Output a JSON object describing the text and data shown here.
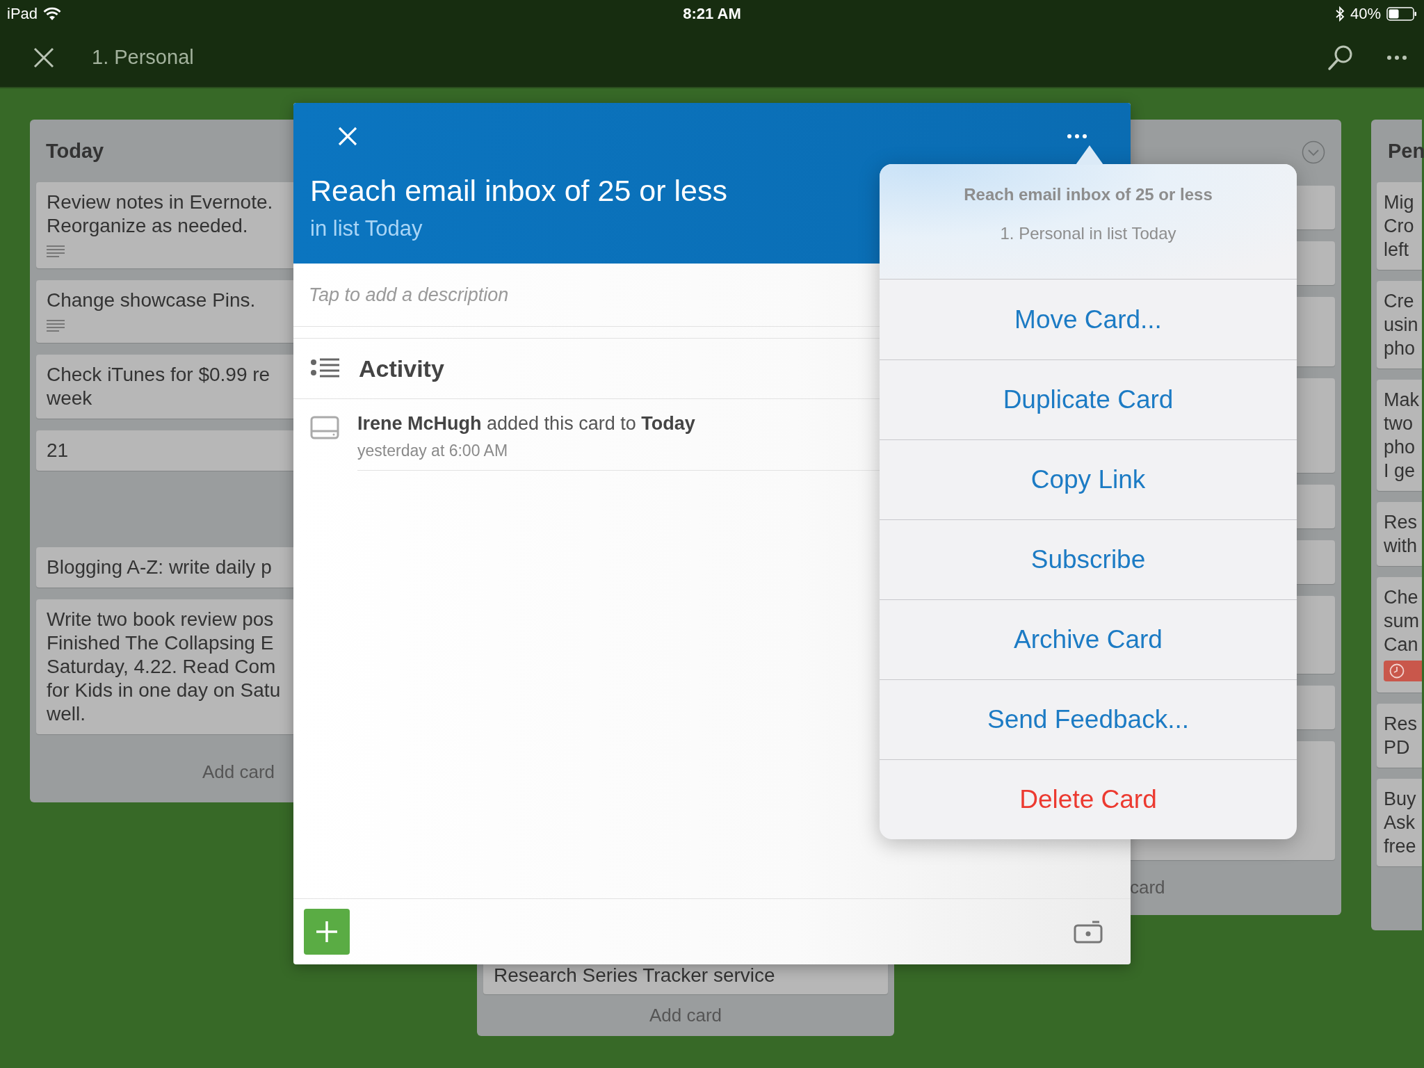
{
  "status_bar": {
    "device": "iPad",
    "time": "8:21 AM",
    "battery": "40%"
  },
  "nav": {
    "title": "1. Personal"
  },
  "lists": [
    {
      "title": "Today",
      "add_label": "Add card",
      "cards": [
        {
          "kind": "card",
          "text": "Review notes in Evernote.\nReorganize as needed.",
          "has_description": true
        },
        {
          "kind": "card",
          "text": "Change showcase Pins.",
          "has_description": true
        },
        {
          "kind": "card",
          "text": "Check iTunes for $0.99 re\nweek"
        },
        {
          "kind": "card",
          "text": "21"
        },
        {
          "kind": "placeholder"
        },
        {
          "kind": "card",
          "text": "Blogging A-Z: write daily p"
        },
        {
          "kind": "card",
          "text": "Write two book review pos\nFinished The Collapsing E\nSaturday, 4.22. Read Com\nfor Kids in one day on Satu\nwell."
        }
      ]
    },
    {
      "add_label": "Add card",
      "cards": [
        {
          "kind": "card",
          "text": "Research Series Tracker service"
        }
      ]
    },
    {
      "add_label": "card",
      "menu_icon": true,
      "cards": [
        {
          "kind": "blank"
        },
        {
          "kind": "blank"
        },
        {
          "kind": "blank"
        },
        {
          "kind": "blank"
        },
        {
          "kind": "blank"
        },
        {
          "kind": "blank"
        },
        {
          "kind": "blank"
        },
        {
          "kind": "blank"
        },
        {
          "kind": "blank"
        }
      ]
    },
    {
      "title": "Pen",
      "cards": [
        {
          "kind": "card",
          "text": "Mig\nCro\nleft"
        },
        {
          "kind": "card",
          "text": "Cre\nusin\npho"
        },
        {
          "kind": "card",
          "text": "Mak\ntwo\npho\nI ge"
        },
        {
          "kind": "card",
          "text": "Res\nwith"
        },
        {
          "kind": "card",
          "text": "Che\nsum\nCan",
          "due_badge": true
        },
        {
          "kind": "card",
          "text": "Res\nPD"
        },
        {
          "kind": "card",
          "text": "Buy\nAsk\nfree"
        }
      ]
    }
  ],
  "dialog": {
    "title": "Reach email inbox of 25 or less",
    "subtitle": "in list Today",
    "description": {
      "placeholder": "Tap to add a description"
    },
    "activity_heading": "Activity",
    "activity": [
      {
        "text": "**Irene McHugh** added this card to **Today**",
        "time": "yesterday at 6:00 AM"
      }
    ]
  },
  "popover": {
    "title": "Reach email inbox of 25 or less",
    "subtitle": "1. Personal in list Today",
    "actions": [
      {
        "label": "Move Card...",
        "kind": "action"
      },
      {
        "label": "Duplicate Card",
        "kind": "action"
      },
      {
        "label": "Copy Link",
        "kind": "action"
      },
      {
        "label": "Subscribe",
        "kind": "action"
      },
      {
        "label": "Archive Card",
        "kind": "action"
      },
      {
        "label": "Send Feedback...",
        "kind": "action"
      },
      {
        "label": "Delete Card",
        "kind": "destructive"
      }
    ]
  }
}
